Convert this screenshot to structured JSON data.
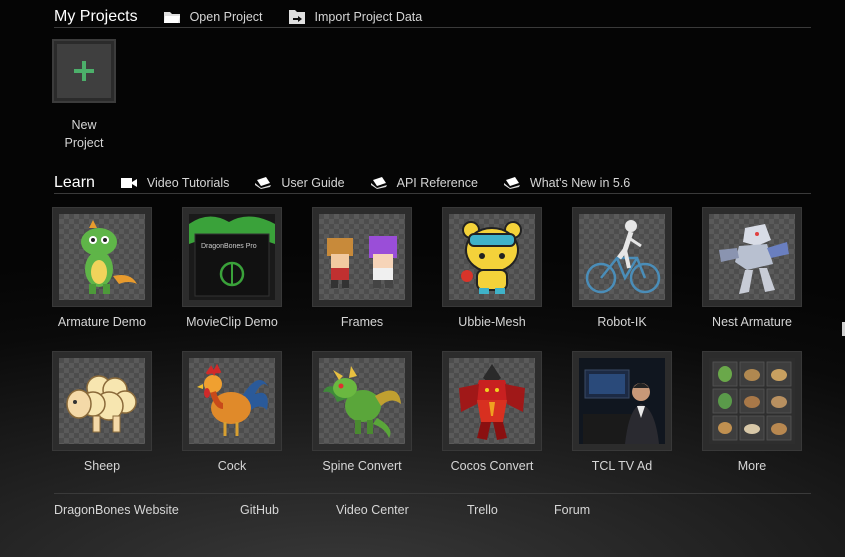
{
  "my_projects": {
    "title": "My Projects",
    "open_project": "Open Project",
    "import_project": "Import Project Data",
    "new_project_line1": "New",
    "new_project_line2": "Project"
  },
  "learn": {
    "title": "Learn",
    "links": [
      "Video Tutorials",
      "User Guide",
      "API Reference",
      "What's New in 5.6"
    ]
  },
  "tiles": [
    {
      "label": "Armature Demo",
      "icon": "dragon-character-icon"
    },
    {
      "label": "MovieClip Demo",
      "icon": "dragonbones-pro-box-icon"
    },
    {
      "label": "Frames",
      "icon": "pixel-characters-icon"
    },
    {
      "label": "Ubbie-Mesh",
      "icon": "yellow-bear-icon"
    },
    {
      "label": "Robot-IK",
      "icon": "robot-bicycle-icon"
    },
    {
      "label": "Nest Armature",
      "icon": "mech-robot-icon"
    },
    {
      "label": "Sheep",
      "icon": "sheep-icon"
    },
    {
      "label": "Cock",
      "icon": "rooster-icon"
    },
    {
      "label": "Spine Convert",
      "icon": "green-dragon-icon"
    },
    {
      "label": "Cocos Convert",
      "icon": "red-demon-icon"
    },
    {
      "label": "TCL TV Ad",
      "icon": "tv-ad-photo-icon"
    },
    {
      "label": "More",
      "icon": "more-thumbnails-icon"
    }
  ],
  "footer": [
    "DragonBones Website",
    "GitHub",
    "Video Center",
    "Trello",
    "Forum"
  ],
  "colors": {
    "accent_green": "#4caf6a",
    "background": "#0a0a0a"
  }
}
